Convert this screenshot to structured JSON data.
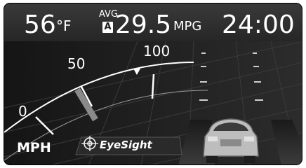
{
  "top_bar": {
    "temperature": "56",
    "temperature_unit": "°F",
    "avg_label": "AVG.",
    "avg_mode_badge": "A",
    "fuel_economy": "29.5",
    "fuel_economy_unit": "MPG",
    "clock": "24:00"
  },
  "speedometer": {
    "tick_labels": [
      "0",
      "50",
      "100"
    ],
    "unit_label": "MPH",
    "set_speed_marker_icon": "triangle-down-icon",
    "needle_value_mph": 55
  },
  "eyesight": {
    "label": "EyeSight",
    "icon": "eyesight-target-icon"
  },
  "vehicle_icon": "car-rear-icon",
  "colors": {
    "background": "#101010",
    "text": "#ffffff",
    "needle": "#8a8a8a"
  }
}
